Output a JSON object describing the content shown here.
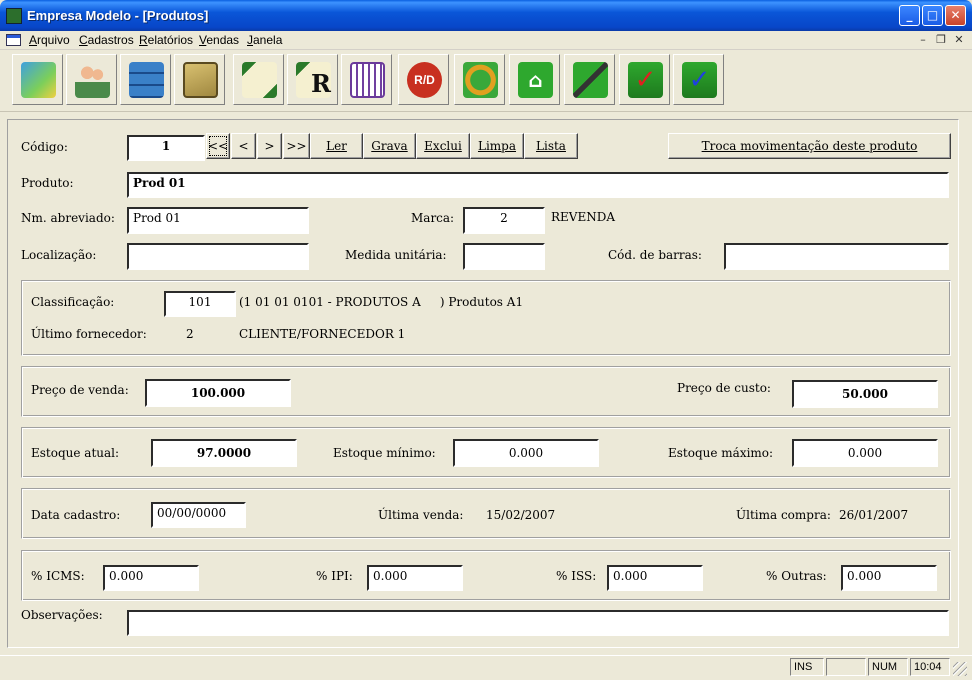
{
  "window": {
    "title": "Empresa Modelo - [Produtos]"
  },
  "menu": {
    "items": [
      "Arquivo",
      "Cadastros",
      "Relatórios",
      "Vendas",
      "Janela"
    ]
  },
  "toolbar": {
    "icons": [
      "map-icon",
      "users-icon",
      "filing-cabinet-icon",
      "folders-icon",
      "edit-document-icon",
      "report-icon",
      "calculator-grid-icon",
      "rd-icon",
      "refresh-icon",
      "home-icon",
      "pen-tool-icon",
      "check-red-icon",
      "check-blue-icon"
    ]
  },
  "form": {
    "codigo": {
      "label": "Código:",
      "value": "1"
    },
    "nav": {
      "first": "<<",
      "prev": "<",
      "next": ">",
      "last": ">>"
    },
    "actions": {
      "ler": "Ler",
      "grava": "Grava",
      "exclui": "Exclui",
      "limpa": "Limpa",
      "lista": "Lista"
    },
    "troca": "Troca movimentação deste produto",
    "produto": {
      "label": "Produto:",
      "value": "Prod 01"
    },
    "nm_abreviado": {
      "label": "Nm. abreviado:",
      "value": "Prod 01"
    },
    "marca": {
      "label": "Marca:",
      "value": "2",
      "name": "REVENDA"
    },
    "localizacao": {
      "label": "Localização:",
      "value": ""
    },
    "medida": {
      "label": "Medida unitária:",
      "value": ""
    },
    "barras": {
      "label": "Cód. de barras:",
      "value": ""
    },
    "classificacao": {
      "label": "Classificação:",
      "value": "101",
      "desc": "(1 01 01 0101 - PRODUTOS A     ) Produtos A1"
    },
    "fornecedor": {
      "label": "Último fornecedor:",
      "value": "2",
      "name": "CLIENTE/FORNECEDOR 1"
    },
    "preco_venda": {
      "label": "Preço de venda:",
      "value": "100.000"
    },
    "preco_custo": {
      "label": "Preço de custo:",
      "value": "50.000"
    },
    "estoque_atual": {
      "label": "Estoque atual:",
      "value": "97.0000"
    },
    "estoque_min": {
      "label": "Estoque mínimo:",
      "value": "0.000"
    },
    "estoque_max": {
      "label": "Estoque máximo:",
      "value": "0.000"
    },
    "data_cadastro": {
      "label": "Data cadastro:",
      "value": "00/00/0000"
    },
    "ultima_venda": {
      "label": "Última venda:",
      "value": "15/02/2007"
    },
    "ultima_compra": {
      "label": "Última compra:",
      "value": "26/01/2007"
    },
    "icms": {
      "label": "% ICMS:",
      "value": "0.000"
    },
    "ipi": {
      "label": "% IPI:",
      "value": "0.000"
    },
    "iss": {
      "label": "% ISS:",
      "value": "0.000"
    },
    "outras": {
      "label": "% Outras:",
      "value": "0.000"
    },
    "obs": {
      "label": "Observações:",
      "value": ""
    }
  },
  "status": {
    "ins": "INS",
    "blank": "",
    "num": "NUM",
    "time": "10:04"
  }
}
